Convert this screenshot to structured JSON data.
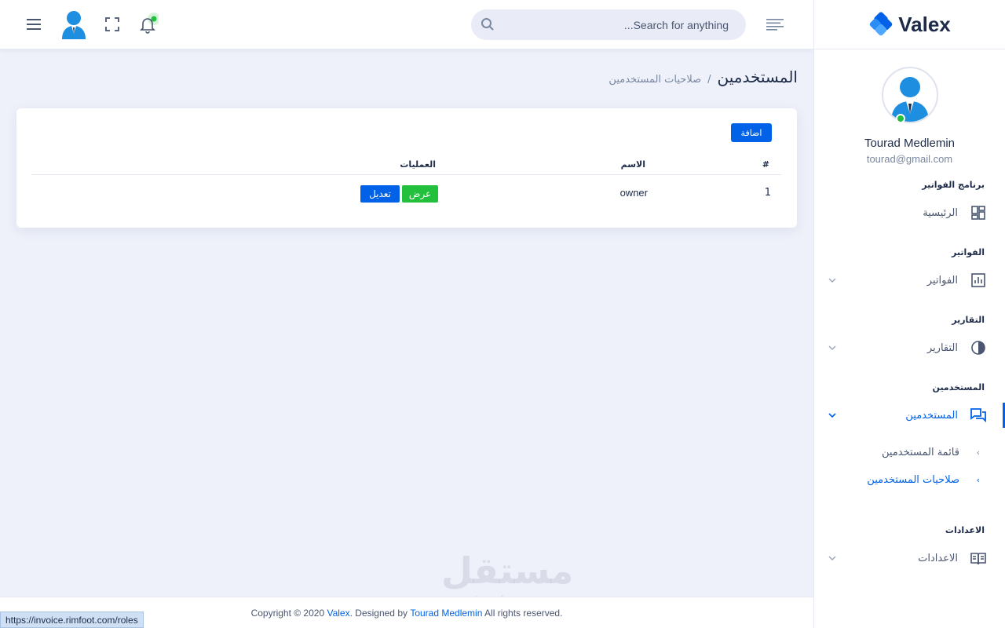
{
  "brand": {
    "logo_text": "Valex",
    "accent": "#0162e8",
    "success": "#22c03c"
  },
  "header": {
    "search_placeholder": "Search for anything...",
    "icons": [
      "menu-icon",
      "user-avatar",
      "fullscreen-icon",
      "bell-icon",
      "sidebar-toggle-icon",
      "search-icon"
    ]
  },
  "profile": {
    "name": "Tourad Medlemin",
    "email": "tourad@gmail.com"
  },
  "sidebar": {
    "cat_main": "برنامج الفواتير",
    "home": "الرئيسية",
    "cat_invoices": "الفواتير",
    "invoices": "الفواتير",
    "cat_reports": "التقارير",
    "reports": "التقارير",
    "cat_users": "المستخدمين",
    "users": "المستخدمين",
    "users_list": "قائمة المستخدمين",
    "users_roles": "صلاحيات المستخدمين",
    "cat_settings": "الاعدادات",
    "settings": "الاعدادات"
  },
  "breadcrumb": {
    "title": "المستخدمين",
    "separator": "/",
    "current": "صلاحيات المستخدمين"
  },
  "card": {
    "add_label": "اضافة",
    "columns": {
      "num": "#",
      "name": "الاسم",
      "actions": "العمليات"
    },
    "rows": [
      {
        "num": "1",
        "name": "owner",
        "view": "عرض",
        "edit": "تعديل"
      }
    ]
  },
  "footer": {
    "prefix": "Copyright © 2020 ",
    "brand": "Valex",
    "middle": ". Designed by ",
    "author": "Tourad Medlemin",
    "suffix": " All rights reserved."
  },
  "watermark": {
    "arabic": "مستقل",
    "latin": "mostaql.com"
  },
  "status_url": "https://invoice.rimfoot.com/roles"
}
